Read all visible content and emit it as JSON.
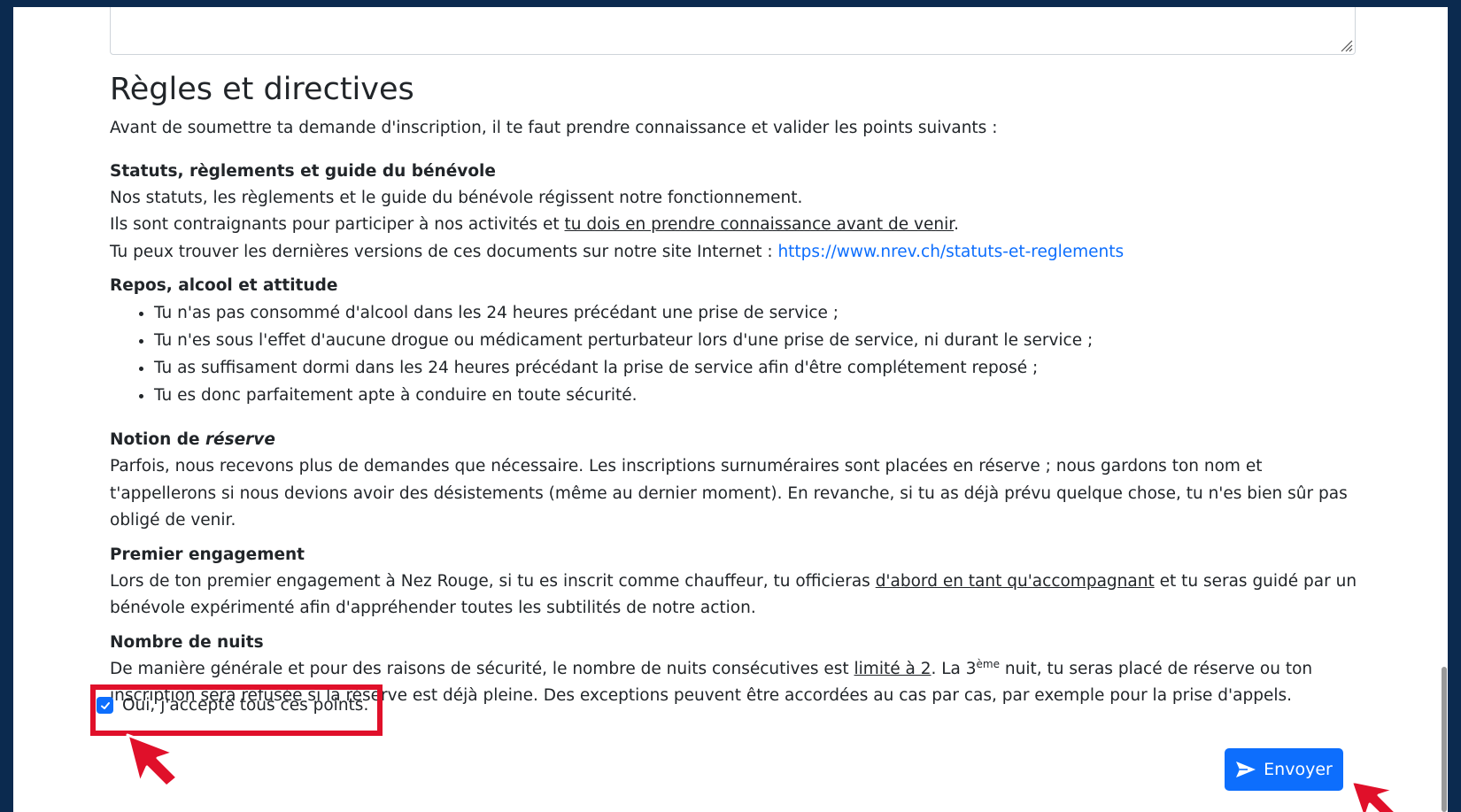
{
  "section": {
    "title": "Règles et directives",
    "intro": "Avant de soumettre ta demande d'inscription, il te faut prendre connaissance et valider les points suivants :"
  },
  "statuts": {
    "title": "Statuts, règlements et guide du bénévole",
    "line1": "Nos statuts, les règlements et le guide du bénévole régissent notre fonctionnement.",
    "line2_pre": "Ils sont contraignants pour participer à nos activités et ",
    "line2_underline": "tu dois en prendre connaissance avant de venir",
    "line2_post": ".",
    "line3_pre": "Tu peux trouver les dernières versions de ces documents sur notre site Internet : ",
    "link": "https://www.nrev.ch/statuts-et-reglements"
  },
  "repos": {
    "title": "Repos, alcool et attitude",
    "items": [
      "Tu n'as pas consommé d'alcool dans les 24 heures précédant une prise de service ;",
      "Tu n'es sous l'effet d'aucune drogue ou médicament perturbateur lors d'une prise de service, ni durant le service ;",
      "Tu as suffisament dormi dans les 24 heures précédant la prise de service afin d'être complétement reposé ;",
      "Tu es donc parfaitement apte à conduire en toute sécurité."
    ]
  },
  "reserve": {
    "title_pre": "Notion de ",
    "title_em": "réserve",
    "text": "Parfois, nous recevons plus de demandes que nécessaire. Les inscriptions surnuméraires sont placées en réserve ; nous gardons ton nom et t'appellerons si nous devions avoir des désistements (même au dernier moment). En revanche, si tu as déjà prévu quelque chose, tu n'es bien sûr pas obligé de venir."
  },
  "engagement": {
    "title": "Premier engagement",
    "text_pre": "Lors de ton premier engagement à Nez Rouge, si tu es inscrit comme chauffeur, tu officieras ",
    "text_underline": "d'abord en tant qu'accompagnant",
    "text_post": " et tu seras guidé par un bénévole expérimenté afin d'appréhender toutes les subtilités de notre action."
  },
  "nuits": {
    "title": "Nombre de nuits",
    "text_pre": "De manière générale et pour des raisons de sécurité, le nombre de nuits consécutives est ",
    "text_underline": "limité à 2",
    "text_mid": ". La 3",
    "text_sup": "ème",
    "text_post": " nuit, tu seras placé de réserve ou ton inscription sera refusée si la réserve est déjà pleine. Des exceptions peuvent être accordées au cas par cas, par exemple pour la prise d'appels."
  },
  "accept": {
    "label": "Oui, j'accepte tous ces points.",
    "checked": true
  },
  "submit": {
    "label": "Envoyer",
    "icon": "send-icon"
  },
  "colors": {
    "background": "#0b2a4f",
    "primary": "#0d6efd",
    "highlight": "#e0102a",
    "link": "#0d6efd"
  }
}
